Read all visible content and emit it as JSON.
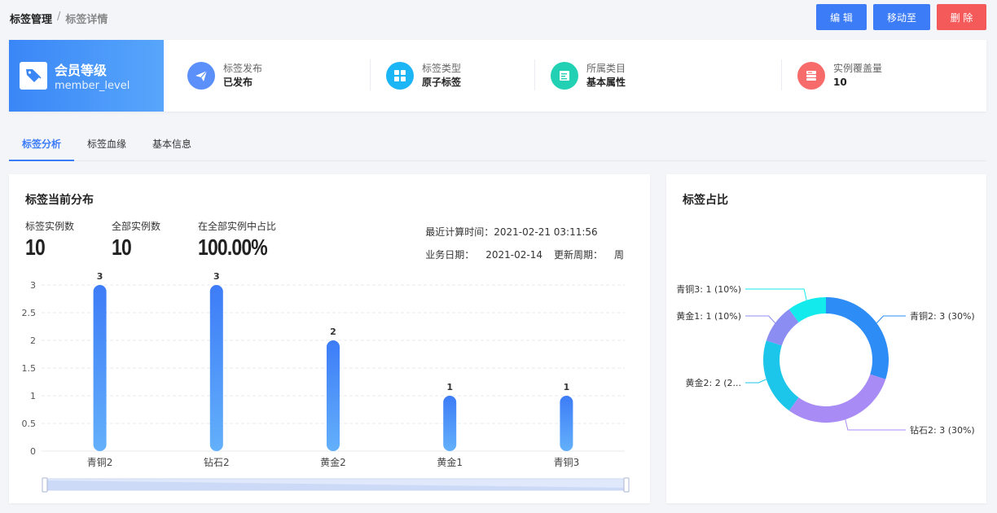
{
  "breadcrumb": {
    "parent": "标签管理",
    "separator": "/",
    "current": "标签详情"
  },
  "actions": {
    "edit": "编 辑",
    "move": "移动至",
    "delete": "删 除"
  },
  "tag": {
    "name": "会员等级",
    "code": "member_level"
  },
  "meta": [
    {
      "label": "标签发布",
      "value": "已发布",
      "icon": "send-icon",
      "color": "#5b8ff9"
    },
    {
      "label": "标签类型",
      "value": "原子标签",
      "icon": "grid-icon",
      "color": "#1cb5f5"
    },
    {
      "label": "所属类目",
      "value": "基本属性",
      "icon": "document-icon",
      "color": "#22d1b4"
    },
    {
      "label": "实例覆盖量",
      "value": "10",
      "icon": "database-icon",
      "color": "#f76b6b"
    }
  ],
  "tabs": [
    {
      "label": "标签分析",
      "active": true
    },
    {
      "label": "标签血缘",
      "active": false
    },
    {
      "label": "基本信息",
      "active": false
    }
  ],
  "distribution": {
    "title": "标签当前分布",
    "stats": [
      {
        "label": "标签实例数",
        "value": "10"
      },
      {
        "label": "全部实例数",
        "value": "10"
      },
      {
        "label": "在全部实例中占比",
        "value": "100.00%"
      }
    ],
    "calc_time_label": "最近计算时间：",
    "calc_time": "2021-02-21 03:11:56",
    "biz_date_label": "业务日期：",
    "biz_date": "2021-02-14",
    "update_cycle_label": "更新周期：",
    "update_cycle": "周"
  },
  "ratio": {
    "title": "标签占比"
  },
  "chart_data": [
    {
      "type": "bar",
      "categories": [
        "青铜2",
        "钻石2",
        "黄金2",
        "黄金1",
        "青铜3"
      ],
      "values": [
        3,
        3,
        2,
        1,
        1
      ],
      "yticks": [
        "0",
        "0.5",
        "1",
        "1.5",
        "2",
        "2.5",
        "3"
      ],
      "ylim": [
        0,
        3
      ],
      "grid": true,
      "bar_color_top": "#3d7cf7",
      "bar_color_bottom": "#63b0fb"
    },
    {
      "type": "pie",
      "slices": [
        {
          "name": "青铜2",
          "value": 3,
          "label": "青铜2: 3 (30%)",
          "color": "#2d8cf5"
        },
        {
          "name": "钻石2",
          "value": 3,
          "label": "钻石2: 3 (30%)",
          "color": "#a98bf5"
        },
        {
          "name": "黄金2",
          "value": 2,
          "label": "黄金2: 2 (2...",
          "color": "#1cc6ea"
        },
        {
          "name": "黄金1",
          "value": 1,
          "label": "黄金1: 1 (10%)",
          "color": "#8c8df3"
        },
        {
          "name": "青铜3",
          "value": 1,
          "label": "青铜3: 1 (10%)",
          "color": "#13eaeb"
        }
      ]
    }
  ]
}
